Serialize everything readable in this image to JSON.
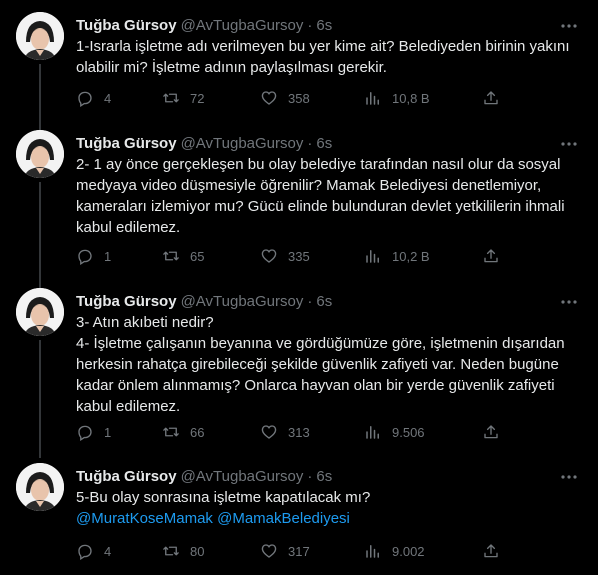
{
  "author": {
    "name": "Tuğba Gürsoy",
    "handle": "@AvTugbaGursoy",
    "time": "6s"
  },
  "tweets": [
    {
      "lines": [
        "1-Israrla işletme adı verilmeyen bu yer kime ait? Belediyeden birinin yakını olabilir mi? İşletme adının paylaşılması gerekir."
      ],
      "replies": "4",
      "retweets": "72",
      "likes": "358",
      "views": "10,8 B"
    },
    {
      "lines": [
        "2- 1 ay önce gerçekleşen bu olay belediye tarafından nasıl olur da sosyal medyaya video düşmesiyle öğrenilir? Mamak Belediyesi denetlemiyor, kameraları izlemiyor mu? Gücü elinde bulunduran devlet yetkililerin ihmali kabul edilemez."
      ],
      "replies": "1",
      "retweets": "65",
      "likes": "335",
      "views": "10,2 B"
    },
    {
      "lines": [
        "3- Atın akıbeti nedir?",
        "4- İşletme çalışanın beyanına ve gördüğümüze göre, işletmenin dışarıdan herkesin rahatça girebileceği şekilde güvenlik zafiyeti var. Neden bugüne kadar önlem alınmamış?  Onlarca hayvan olan bir yerde güvenlik zafiyeti kabul edilemez."
      ],
      "replies": "1",
      "retweets": "66",
      "likes": "313",
      "views": "9.506"
    },
    {
      "lines": [
        "5-Bu olay sonrasına işletme kapatılacak mı?"
      ],
      "mentions": [
        "@MuratKoseMamak",
        "@MamakBelediyesi"
      ],
      "replies": "4",
      "retweets": "80",
      "likes": "317",
      "views": "9.002"
    }
  ]
}
